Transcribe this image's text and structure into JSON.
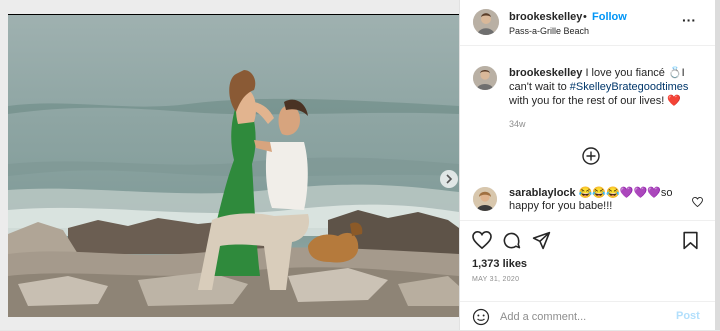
{
  "post": {
    "username": "brookeskelley",
    "dot": "•",
    "follow_label": "Follow",
    "location": "Pass-a-Grille Beach",
    "caption_text": "I love you fiancé 💍I can't wait to ",
    "caption_hashtag": "#SkelleyBrategoodtimes",
    "caption_end": " with you for the rest of our lives! ❤️",
    "caption_time": "34w",
    "likes": "1,373 likes",
    "date": "MAY 31, 2020",
    "comment": {
      "username": "sarablaylock",
      "text": " 😂😂😂💜💜💜so happy for you babe!!!"
    },
    "add_comment_placeholder": "Add a comment...",
    "post_label": "Post"
  },
  "icons": [
    "more-icon",
    "plus-circle-icon",
    "heart-icon",
    "comment-icon",
    "share-icon",
    "bookmark-icon",
    "emoji-icon",
    "chevron-right-icon"
  ],
  "colors": {
    "link_blue": "#0095f6",
    "hashtag": "#00376b",
    "muted": "#8e8e8e",
    "post_disabled": "#b2dffc"
  }
}
